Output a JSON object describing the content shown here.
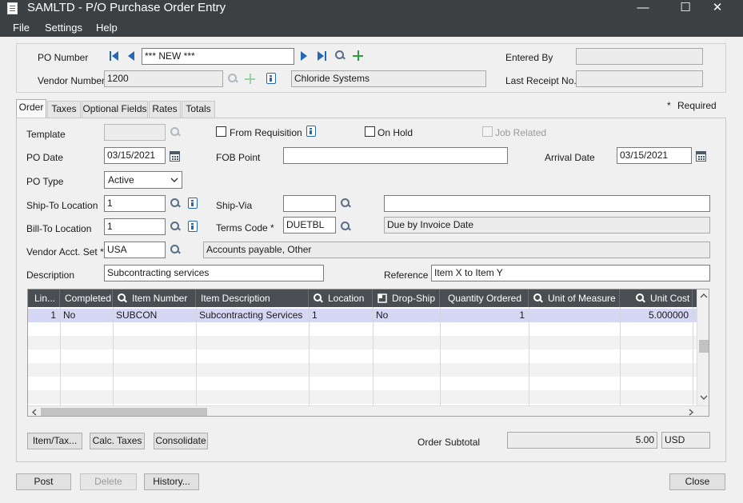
{
  "window": {
    "title": "SAMLTD - P/O Purchase Order Entry",
    "minimize": "—",
    "maximize": "☐",
    "close": "✕"
  },
  "menu": {
    "file": "File",
    "settings": "Settings",
    "help": "Help"
  },
  "header": {
    "po_number_label": "PO Number",
    "po_number_value": "*** NEW ***",
    "vendor_number_label": "Vendor Number",
    "vendor_number_value": "1200",
    "vendor_name": "Chloride Systems",
    "entered_by_label": "Entered By",
    "entered_by_value": "",
    "last_receipt_label": "Last Receipt No.",
    "last_receipt_value": ""
  },
  "tabs": [
    "Order",
    "Taxes",
    "Optional Fields",
    "Rates",
    "Totals"
  ],
  "required_note": "Required",
  "required_star": "*",
  "order": {
    "template_label": "Template",
    "template_value": "",
    "from_requisition_label": "From Requisition",
    "on_hold_label": "On Hold",
    "job_related_label": "Job Related",
    "po_date_label": "PO Date",
    "po_date_value": "03/15/2021",
    "fob_point_label": "FOB Point",
    "fob_point_value": "",
    "arrival_date_label": "Arrival Date",
    "arrival_date_value": "03/15/2021",
    "po_type_label": "PO Type",
    "po_type_value": "Active",
    "ship_to_label": "Ship-To Location",
    "ship_to_value": "1",
    "ship_via_label": "Ship-Via",
    "ship_via_value": "",
    "ship_via_desc": "",
    "bill_to_label": "Bill-To Location",
    "bill_to_value": "1",
    "terms_code_label": "Terms Code",
    "terms_code_value": "DUETBL",
    "terms_code_desc": "Due by Invoice Date",
    "vendor_acct_set_label": "Vendor Acct. Set",
    "vendor_acct_set_value": "USA",
    "vendor_acct_set_desc": "Accounts payable, Other",
    "description_label": "Description",
    "description_value": "Subcontracting services",
    "reference_label": "Reference",
    "reference_value": "Item X to Item Y"
  },
  "grid": {
    "columns": [
      "Lin...",
      "Completed",
      "Item Number",
      "Item Description",
      "Location",
      "Drop-Ship",
      "Quantity Ordered",
      "Unit of Measure",
      "Unit Cost"
    ],
    "rows": [
      [
        "1",
        "No",
        "SUBCON",
        "Subcontracting Services",
        "1",
        "No",
        "1",
        "",
        "5.000000"
      ]
    ]
  },
  "buttons": {
    "item_tax": "Item/Tax...",
    "calc_taxes": "Calc. Taxes",
    "consolidate": "Consolidate",
    "post": "Post",
    "delete": "Delete",
    "history": "History...",
    "close": "Close"
  },
  "subtotal": {
    "label": "Order Subtotal",
    "value": "5.00",
    "currency": "USD"
  }
}
